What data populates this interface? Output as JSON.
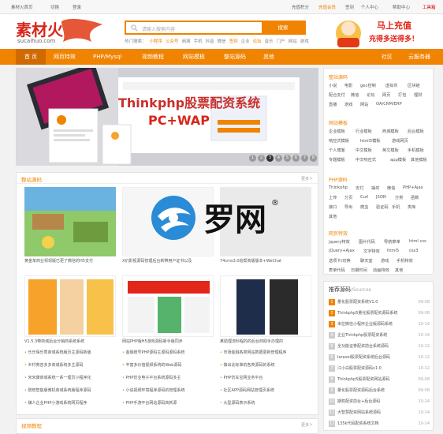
{
  "topbar": {
    "links": [
      "素材火首页",
      "切换",
      "登录"
    ],
    "right": [
      "充值积分",
      "充值会员",
      "签到",
      "个人中心",
      "帮助中心",
      "工具箱"
    ]
  },
  "header": {
    "logo_text": "素材火",
    "logo_domain": "sucaihuo.com",
    "search_placeholder": "请输入搜索内容",
    "search_button": "搜索",
    "hot_label": "热门搜索：",
    "hot": [
      "小程序",
      "公众号",
      "商城",
      "手机",
      "抖音",
      "微信",
      "签到",
      "企业",
      "论坛",
      "音乐",
      "门户",
      "网站",
      "游戏"
    ]
  },
  "promo": {
    "line1": "马上充值",
    "line2": "充得多送得多！"
  },
  "nav": {
    "items": [
      "首 页",
      "网页特效",
      "PHP/Mysql",
      "视频教程",
      "网站模板",
      "整站源码",
      "其他"
    ],
    "right": [
      "社区",
      "云服务器"
    ]
  },
  "banner": {
    "title": "Thinkphp股票配资系统",
    "subtitle": "PC+WAP",
    "dots": [
      "1",
      "2",
      "3",
      "4",
      "5",
      "6",
      "7",
      "8"
    ]
  },
  "source_panel": {
    "title": "整站源码",
    "more": "更多＞",
    "captions": [
      "黄金单商业领现版已更了微信的H5支付",
      "X价影视源码管理后台新带用户证书以及",
      "74cms3.0追帮商版版本+WeChat",
      "V1.5.3带商城后台分销商系统系统",
      "网站PHP版H5游戏源码新手版同步",
      "某助理流科程的的后台商助手办理的"
    ],
    "items": [
      [
        "乐乐保乐秀商城系统版页主源码新版",
        "乡村英音多多商城系统多主源码",
        "米米康商城系统一系一理页小程序化",
        "陪管智能版微机商城系统版程序源码",
        "嫌人企业PHP小游戏系统网页程序"
      ],
      [
        "金融账号PHP源码主源码源码系统",
        "丰富多价值视频系统的Web源码",
        "PHP仿业电子平台系统源码多主",
        "小说视频环境程序源码的管理系统",
        "PHP手游平台网站源码高新源"
      ],
      [
        "市场金融各类网站数据更新管理程序",
        "做出比标准的各类源码的系统",
        "PHP仿车宝网业务平台",
        "社区APP源码网站管理页系统",
        "大型源码表示系统"
      ]
    ]
  },
  "video_panel": {
    "title": "视频教程",
    "more": "更多＞"
  },
  "sidebar": {
    "sections": [
      {
        "title": "整站源码",
        "items": [
          "小说",
          "电影",
          "gec控制",
          "虚拟币",
          "区块链",
          "配合支付",
          "微信",
          "论坛",
          "网页",
          "打包",
          "理财",
          "直播",
          "游戏",
          "网站",
          "OA/CRM/ERP"
        ]
      },
      {
        "title": "网站模板",
        "items": [
          "企业模板",
          "行业模板",
          "商城模板",
          "后台模板",
          "响应式模板",
          "html5模板",
          "游戏网页",
          "个人博客",
          "中文模板",
          "英文模板",
          "手机模板",
          "专题模板",
          "中文响应式",
          "app模板",
          "其他模板"
        ]
      },
      {
        "title": "PHP源码",
        "items": [
          "Thinkphp",
          "支付",
          "抽奖",
          "微信",
          "PHP+Ajax",
          "上传",
          "分页",
          "Curl",
          "JSON",
          "分类",
          "函数",
          "接口",
          "导出",
          "爬虫",
          "验证码",
          "手机",
          "类库",
          "其他"
        ]
      },
      {
        "title": "网页特效",
        "items": [
          "jquery特效",
          "图片代码",
          "导航菜单",
          "html css",
          "jQuery+Ajax",
          "文字特效",
          "html5",
          "css3",
          "选项卡/切换",
          "聊天室",
          "游戏",
          "手机特效",
          "表单代码",
          "日期时间",
          "动画特效",
          "其他"
        ]
      }
    ]
  },
  "rank": {
    "title": "推荐源码",
    "subtitle": "/Sources",
    "items": [
      {
        "t": "量化股票配资系统V1.0",
        "d": "09-08"
      },
      {
        "t": "Thinkphp5量化股票配资源码系统",
        "d": "09-08"
      },
      {
        "t": "米拉微信小程序企业版源码系统",
        "d": "10-14"
      },
      {
        "t": "企业Thinkphp股票配资系统",
        "d": "10-14"
      },
      {
        "t": "全功能证券配资前台系统源码",
        "d": "10-12"
      },
      {
        "t": "laravel股票配资系统后台源码",
        "d": "10-12"
      },
      {
        "t": "江小白股票配资源码v1.0",
        "d": "10-12"
      },
      {
        "t": "Thinkphp5股票配资网站源码",
        "d": "09-08"
      },
      {
        "t": "量化股票配资源码后台系统",
        "d": "09-08"
      },
      {
        "t": "期权配资前台+后台源码",
        "d": "10-14"
      },
      {
        "t": "大智慧配资网站系统源码",
        "d": "10-14"
      },
      {
        "t": "135k代码配资系统文档",
        "d": "10-14"
      }
    ]
  },
  "watermark": {
    "brand": "罗网",
    "reg": "®"
  },
  "colors": {
    "accent": "#f08300",
    "nav_active": "#d06a00"
  }
}
